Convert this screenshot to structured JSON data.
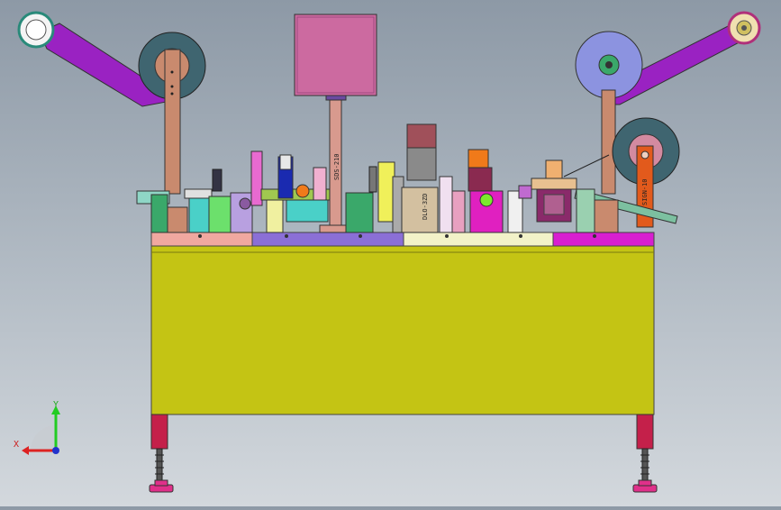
{
  "viewport": {
    "background_top": "#8d99a6",
    "background_bottom": "#d3d8dd"
  },
  "machine": {
    "cabinet_color": "#c4c414",
    "left_arm_color": "#9a22c2",
    "right_arm_color": "#9a22c2",
    "left_reel_color": "#3f6570",
    "right_top_reel_color": "#8c93e0",
    "right_lower_reel_color": "#3f6570",
    "top_box_color": "#cc6aa0",
    "leg_color": "#c4204a",
    "foot_color": "#e0308a",
    "plate_segments": [
      "#f0a8a0",
      "#8b6fd6",
      "#f2f2c8",
      "#d81fd0"
    ]
  },
  "labels": {
    "column_label": "SDS-210",
    "center_block_label": "DLO-3ZD",
    "right_block_label": "SIGN-10"
  },
  "triad": {
    "y_label": "Y",
    "x_label": "X",
    "y_color": "#22cc22",
    "x_color": "#dd2222",
    "z_color": "#2233cc"
  }
}
